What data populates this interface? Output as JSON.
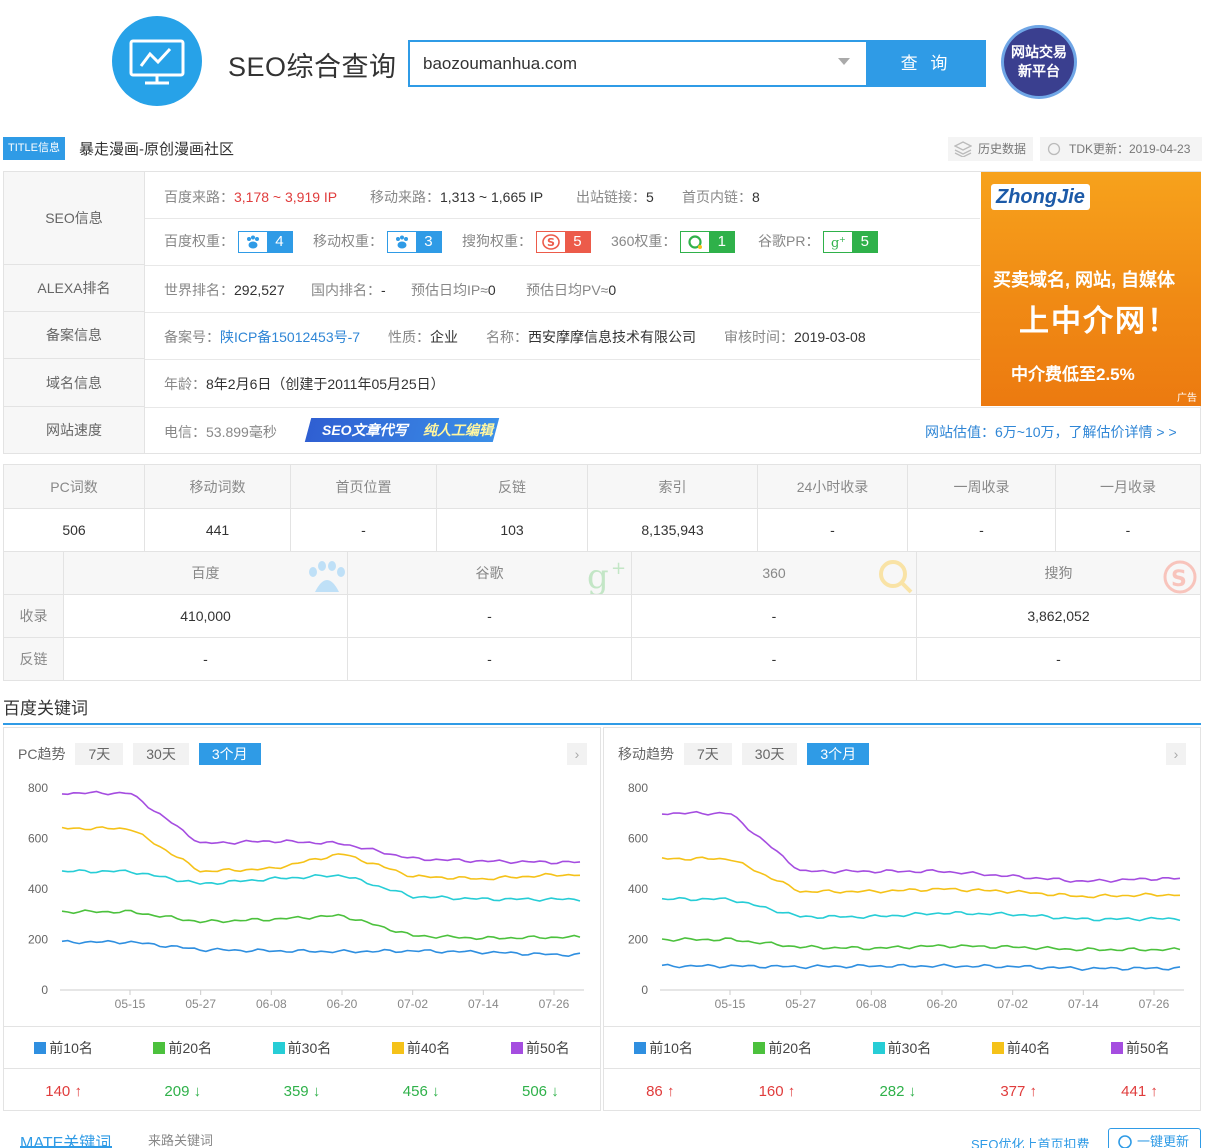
{
  "header": {
    "title": "SEO综合查询",
    "search_value": "baozoumanhua.com",
    "search_button": "查 询",
    "trade_badge_line1": "网站交易",
    "trade_badge_line2": "新平台"
  },
  "title_row": {
    "tag": "TITLE信息",
    "title": "暴走漫画-原创漫画社区",
    "history": "历史数据",
    "tdk": "TDK更新：2019-04-23"
  },
  "seo": {
    "labels": {
      "seo": "SEO信息",
      "alexa": "ALEXA排名",
      "beian": "备案信息",
      "domain": "域名信息",
      "speed": "网站速度"
    },
    "baidu_traffic_label": "百度来路：",
    "baidu_traffic": "3,178 ~ 3,919 IP",
    "mobile_traffic_label": "移动来路：",
    "mobile_traffic": "1,313 ~ 1,665 IP",
    "outlinks_label": "出站链接：",
    "outlinks": "5",
    "inlinks_label": "首页内链：",
    "inlinks": "8",
    "baidu_weight_label": "百度权重：",
    "baidu_weight": "4",
    "mobile_weight_label": "移动权重：",
    "mobile_weight": "3",
    "sogou_weight_label": "搜狗权重：",
    "sogou_weight": "5",
    "w360_label": "360权重：",
    "w360": "1",
    "google_pr_label": "谷歌PR：",
    "google_pr": "5",
    "world_rank_label": "世界排名：",
    "world_rank": "292,527",
    "cn_rank_label": "国内排名：",
    "cn_rank": "-",
    "daily_ip_label": "预估日均IP≈",
    "daily_ip": "0",
    "daily_pv_label": "预估日均PV≈",
    "daily_pv": "0",
    "icp_label": "备案号：",
    "icp": "陕ICP备15012453号-7",
    "nature_label": "性质：",
    "nature": "企业",
    "company_label": "名称：",
    "company": "西安摩摩信息技术有限公司",
    "audit_label": "审核时间：",
    "audit": "2019-03-08",
    "age_label": "年龄：",
    "age": "8年2月6日（创建于2011年05月25日）",
    "speed_value": "电信：53.899毫秒",
    "banner_a": "SEO文章代写",
    "banner_b": "纯人工编辑",
    "valuation": "网站估值：6万~10万，了解估价详情 > >"
  },
  "ad": {
    "logo": "ZhongJie",
    "line1": "买卖域名, 网站, 自媒体",
    "line2": "上中介网！",
    "line3": "中介费低至2.5%",
    "mark": "广告"
  },
  "stats": {
    "headers": [
      "PC词数",
      "移动词数",
      "首页位置",
      "反链",
      "索引",
      "24小时收录",
      "一周收录",
      "一月收录"
    ],
    "values": [
      "506",
      "441",
      "-",
      "103",
      "8,135,943",
      "-",
      "-",
      "-"
    ]
  },
  "engines": {
    "headers": [
      "百度",
      "谷歌",
      "360",
      "搜狗"
    ],
    "rows": [
      {
        "label": "收录",
        "values": [
          "410,000",
          "-",
          "-",
          "3,862,052"
        ]
      },
      {
        "label": "反链",
        "values": [
          "-",
          "-",
          "-",
          "-"
        ]
      }
    ]
  },
  "keywords": {
    "title": "百度关键词",
    "tabs": [
      "7天",
      "30天",
      "3个月"
    ],
    "pc_label": "PC趋势",
    "mobile_label": "移动趋势",
    "legend": [
      "前10名",
      "前20名",
      "前30名",
      "前40名",
      "前50名"
    ],
    "colors": [
      "#2f8fe0",
      "#4cc13d",
      "#27cdd6",
      "#f5c219",
      "#a54de0"
    ],
    "pc_values": [
      "140",
      "209",
      "359",
      "456",
      "506"
    ],
    "pc_dir": [
      "up",
      "down",
      "down",
      "down",
      "down"
    ],
    "mobile_values": [
      "86",
      "160",
      "282",
      "377",
      "441"
    ],
    "mobile_dir": [
      "up",
      "up",
      "down",
      "up",
      "up"
    ],
    "bottom_tab1": "MATE关键词",
    "bottom_tab2": "来路关键词",
    "bottom_r1": "SEO优化上首页扣费",
    "bottom_r2": "一键更新"
  },
  "chart_data": [
    {
      "type": "line",
      "title": "",
      "xlabel": "",
      "ylabel": "",
      "ylim": [
        0,
        800
      ],
      "x": [
        "05-15",
        "05-27",
        "06-08",
        "06-20",
        "07-02",
        "07-14",
        "07-26"
      ],
      "series": [
        {
          "name": "前10名",
          "values": [
            190,
            160,
            155,
            152,
            155,
            150,
            140
          ]
        },
        {
          "name": "前20名",
          "values": [
            310,
            270,
            280,
            295,
            215,
            205,
            209
          ]
        },
        {
          "name": "前30名",
          "values": [
            470,
            420,
            440,
            455,
            370,
            360,
            359
          ]
        },
        {
          "name": "前40名",
          "values": [
            640,
            470,
            480,
            540,
            450,
            440,
            456
          ]
        },
        {
          "name": "前50名",
          "values": [
            780,
            580,
            590,
            580,
            520,
            510,
            506
          ]
        }
      ]
    },
    {
      "type": "line",
      "title": "",
      "xlabel": "",
      "ylabel": "",
      "ylim": [
        0,
        800
      ],
      "x": [
        "05-15",
        "05-27",
        "06-08",
        "06-20",
        "07-02",
        "07-14",
        "07-26"
      ],
      "series": [
        {
          "name": "前10名",
          "values": [
            95,
            92,
            95,
            95,
            93,
            85,
            86
          ]
        },
        {
          "name": "前20名",
          "values": [
            200,
            170,
            165,
            175,
            170,
            160,
            160
          ]
        },
        {
          "name": "前30名",
          "values": [
            360,
            290,
            290,
            305,
            300,
            280,
            282
          ]
        },
        {
          "name": "前40名",
          "values": [
            520,
            390,
            390,
            400,
            390,
            370,
            377
          ]
        },
        {
          "name": "前50名",
          "values": [
            700,
            470,
            470,
            470,
            450,
            430,
            441
          ]
        }
      ]
    }
  ]
}
